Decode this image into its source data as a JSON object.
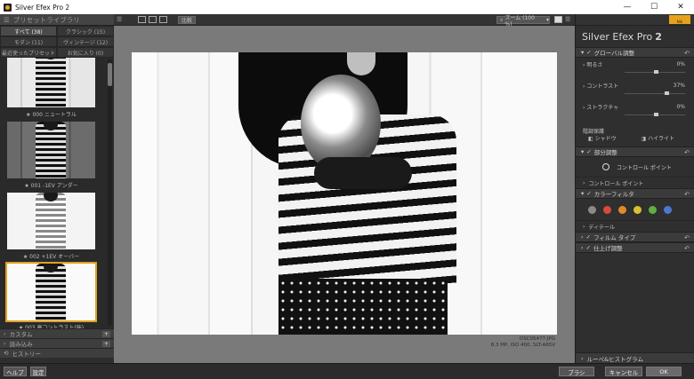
{
  "window": {
    "title": "Silver Efex Pro 2",
    "minimize": "—",
    "maximize": "☐",
    "close": "✕"
  },
  "left_panel": {
    "header": "プリセットライブラリ",
    "tabs": [
      {
        "label": "すべて (38)",
        "active": true
      },
      {
        "label": "クラシック (15)",
        "active": false
      },
      {
        "label": "モダン (11)",
        "active": false
      },
      {
        "label": "ヴィンテージ (12)",
        "active": false
      },
      {
        "label": "最近使ったプリセット",
        "active": false
      },
      {
        "label": "お気に入り (0)",
        "active": false
      }
    ],
    "presets": [
      {
        "label": "★ 000 ニュートラル",
        "style": "normal",
        "selected": false
      },
      {
        "label": "★ 001 -1EV アンダー",
        "style": "dark",
        "selected": false
      },
      {
        "label": "★ 002 +1EV オーバー",
        "style": "bright",
        "selected": false
      },
      {
        "label": "★ 003 高コントラスト(強)",
        "style": "high",
        "selected": true
      }
    ],
    "sections": [
      {
        "label": "カスタム",
        "button": "+"
      },
      {
        "label": "読み込み",
        "button": "+"
      },
      {
        "label": "ヒストリー",
        "button": ""
      }
    ]
  },
  "toolbar": {
    "compare_label": "比較",
    "zoom_label": "ズーム (100 %)"
  },
  "image": {
    "filename": "DSC05477.JPG",
    "meta": "8.3 MP, ISO 400, SLT-A65V"
  },
  "right_panel": {
    "brand": "Silver Efex Pro",
    "brand_version": "2",
    "logo_text": "Nik",
    "global_section": "グローバル調整",
    "sliders": [
      {
        "label": "明るさ",
        "value": "0%",
        "pos": 0.5
      },
      {
        "label": "コントラスト",
        "value": "37%",
        "pos": 0.68
      },
      {
        "label": "ストラクチャ",
        "value": "0%",
        "pos": 0.5
      }
    ],
    "tone_label": "階調保護",
    "tone_options": [
      "シャドウ",
      "ハイライト"
    ],
    "local_section": "部分調整",
    "control_point": "コントロール ポイント",
    "control_points_row": "コントロール ポイント",
    "filter_section": "カラーフィルタ",
    "filter_colors": [
      "#8a8a8a",
      "#d84a3a",
      "#e08a28",
      "#d8c030",
      "#60b040",
      "#4a7ad0"
    ],
    "detail_row": "ディテール",
    "film_section": "フィルム タイプ",
    "finish_section": "仕上げ調整",
    "histogram": "ルーペ&ヒストグラム"
  },
  "bottom": {
    "help": "ヘルプ",
    "settings": "設定",
    "brush": "ブラシ",
    "cancel": "キャンセル",
    "ok": "OK"
  }
}
